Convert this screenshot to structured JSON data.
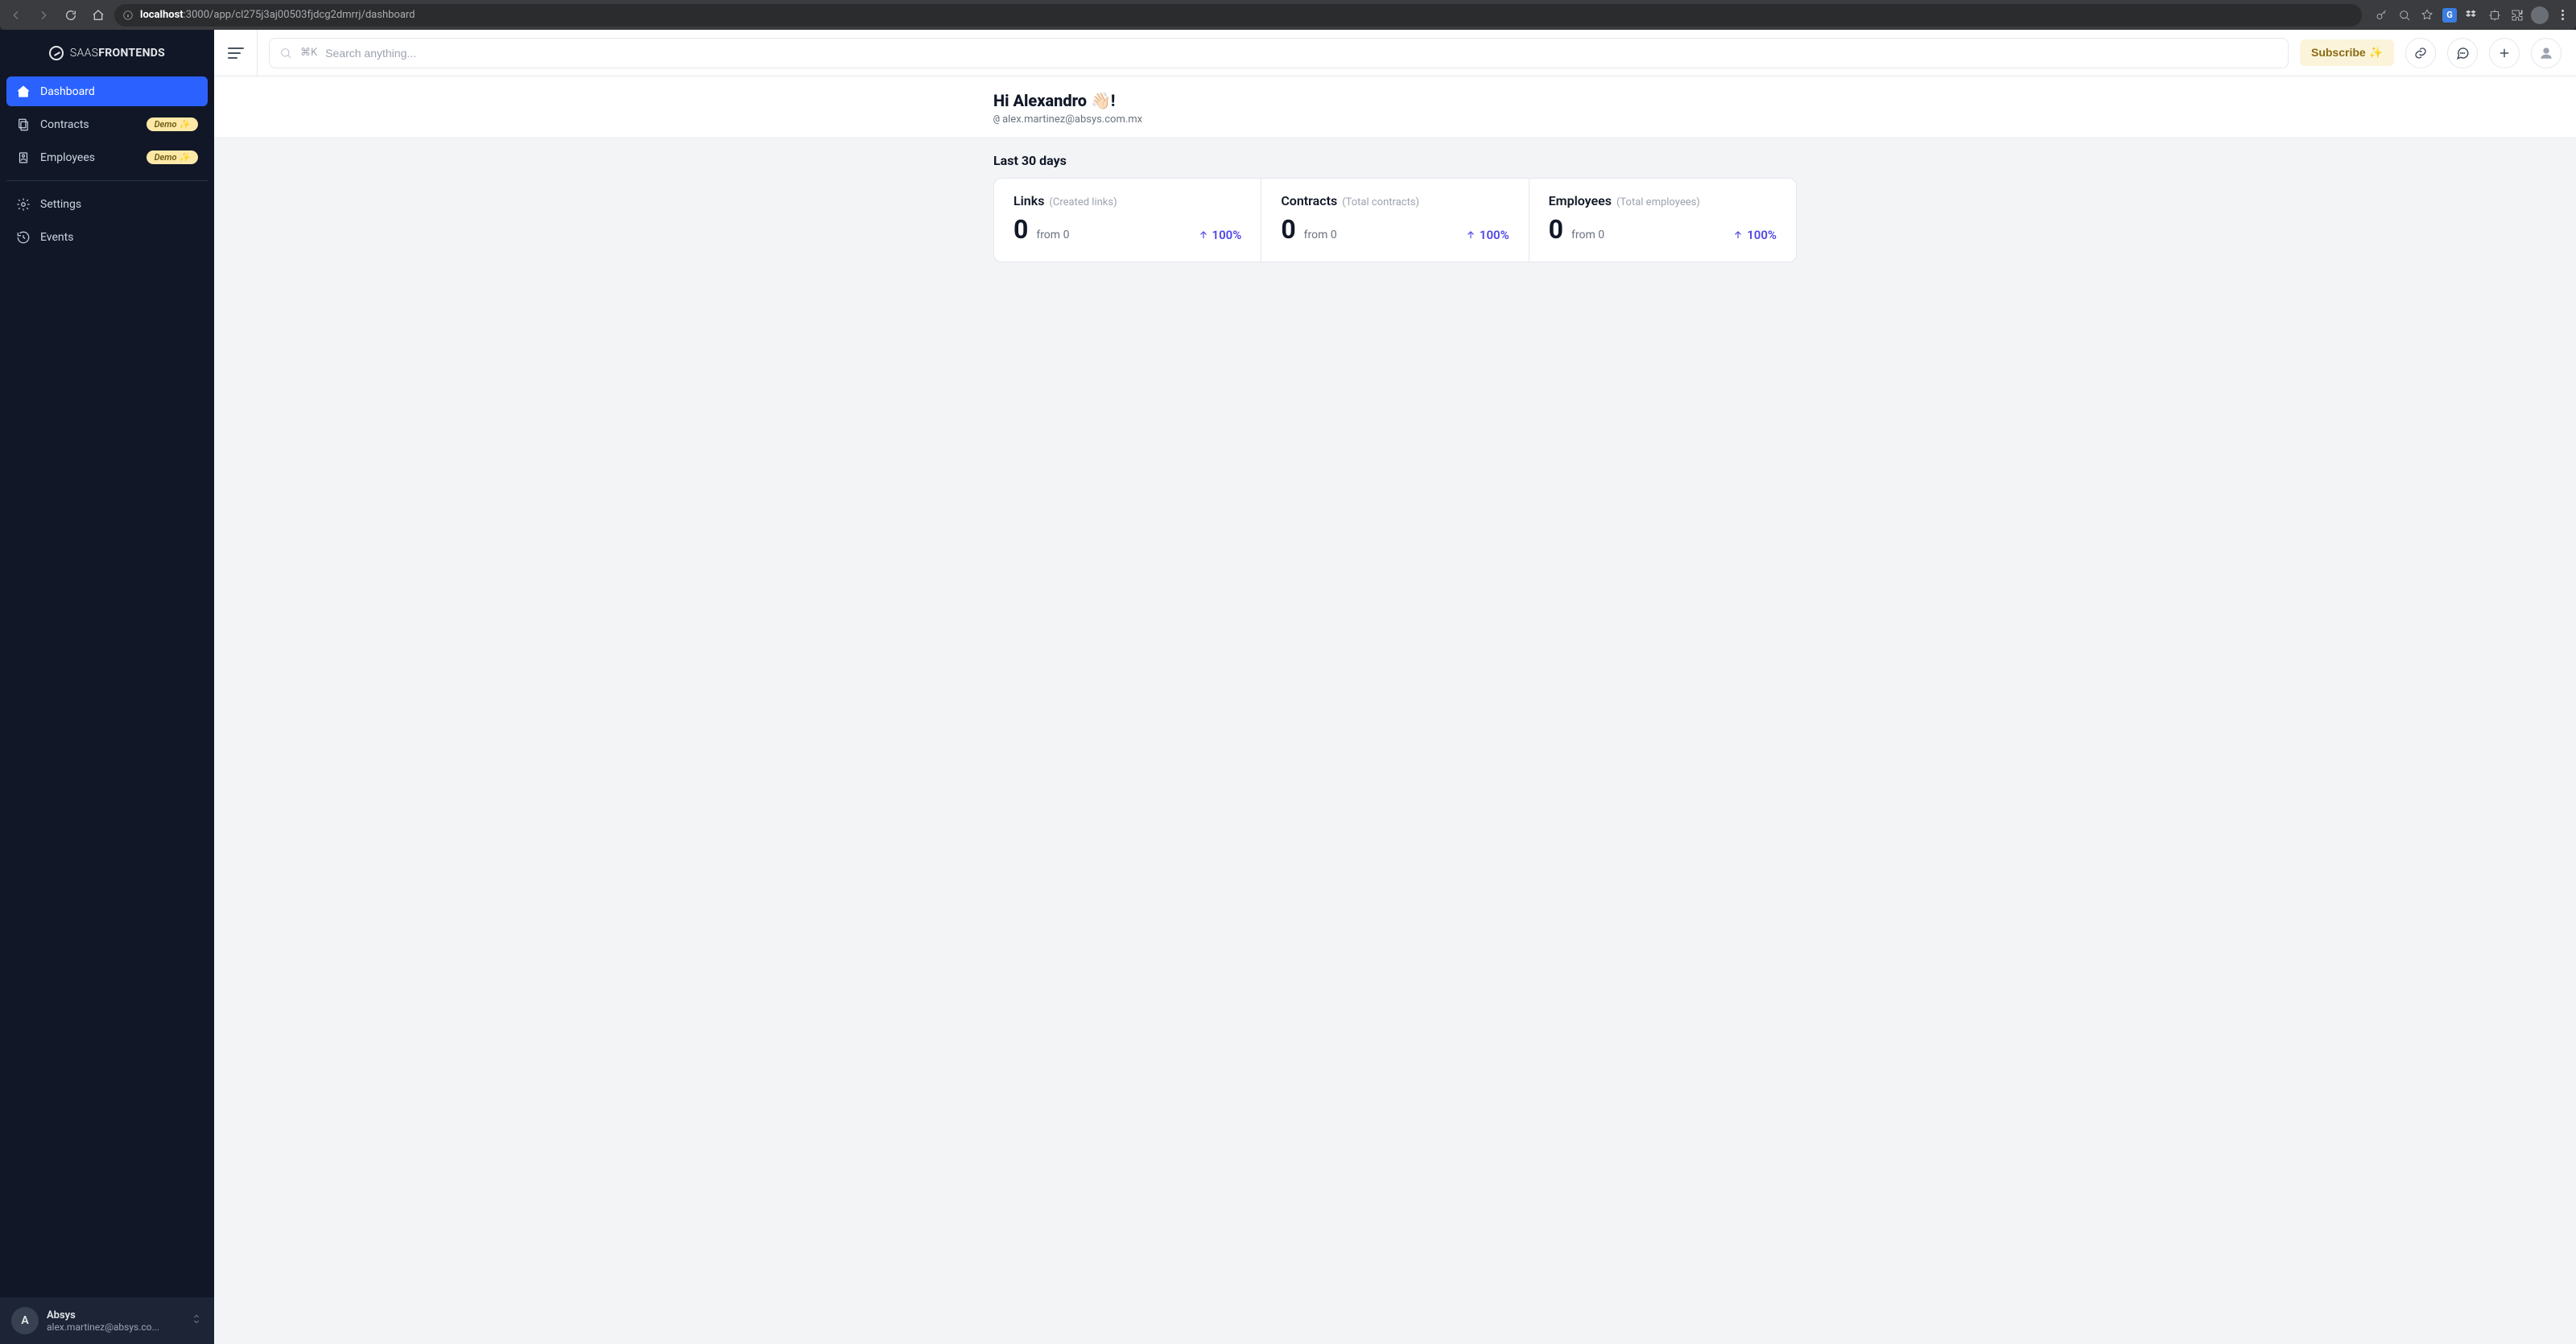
{
  "browser": {
    "url_host": "localhost",
    "url_path": ":3000/app/cl275j3aj00503fjdcg2dmrrj/dashboard"
  },
  "brand": {
    "thin": "SAAS",
    "bold": "FRONTENDS"
  },
  "sidebar": {
    "items": [
      {
        "label": "Dashboard",
        "badge": null
      },
      {
        "label": "Contracts",
        "badge": "Demo ✨"
      },
      {
        "label": "Employees",
        "badge": "Demo ✨"
      }
    ],
    "secondary": [
      {
        "label": "Settings"
      },
      {
        "label": "Events"
      }
    ]
  },
  "account": {
    "initial": "A",
    "name": "Absys",
    "email": "alex.martinez@absys.co..."
  },
  "topbar": {
    "search_kbd": "⌘K",
    "search_placeholder": "Search anything...",
    "subscribe": "Subscribe ✨"
  },
  "hero": {
    "greeting": "Hi Alexandro 👋🏻!",
    "at": "@",
    "email": "alex.martinez@absys.com.mx"
  },
  "dashboard": {
    "section_title": "Last 30 days",
    "stats": [
      {
        "title": "Links",
        "hint": "(Created links)",
        "value": "0",
        "from_label": "from",
        "from_value": "0",
        "delta": "100%"
      },
      {
        "title": "Contracts",
        "hint": "(Total contracts)",
        "value": "0",
        "from_label": "from",
        "from_value": "0",
        "delta": "100%"
      },
      {
        "title": "Employees",
        "hint": "(Total employees)",
        "value": "0",
        "from_label": "from",
        "from_value": "0",
        "delta": "100%"
      }
    ]
  }
}
